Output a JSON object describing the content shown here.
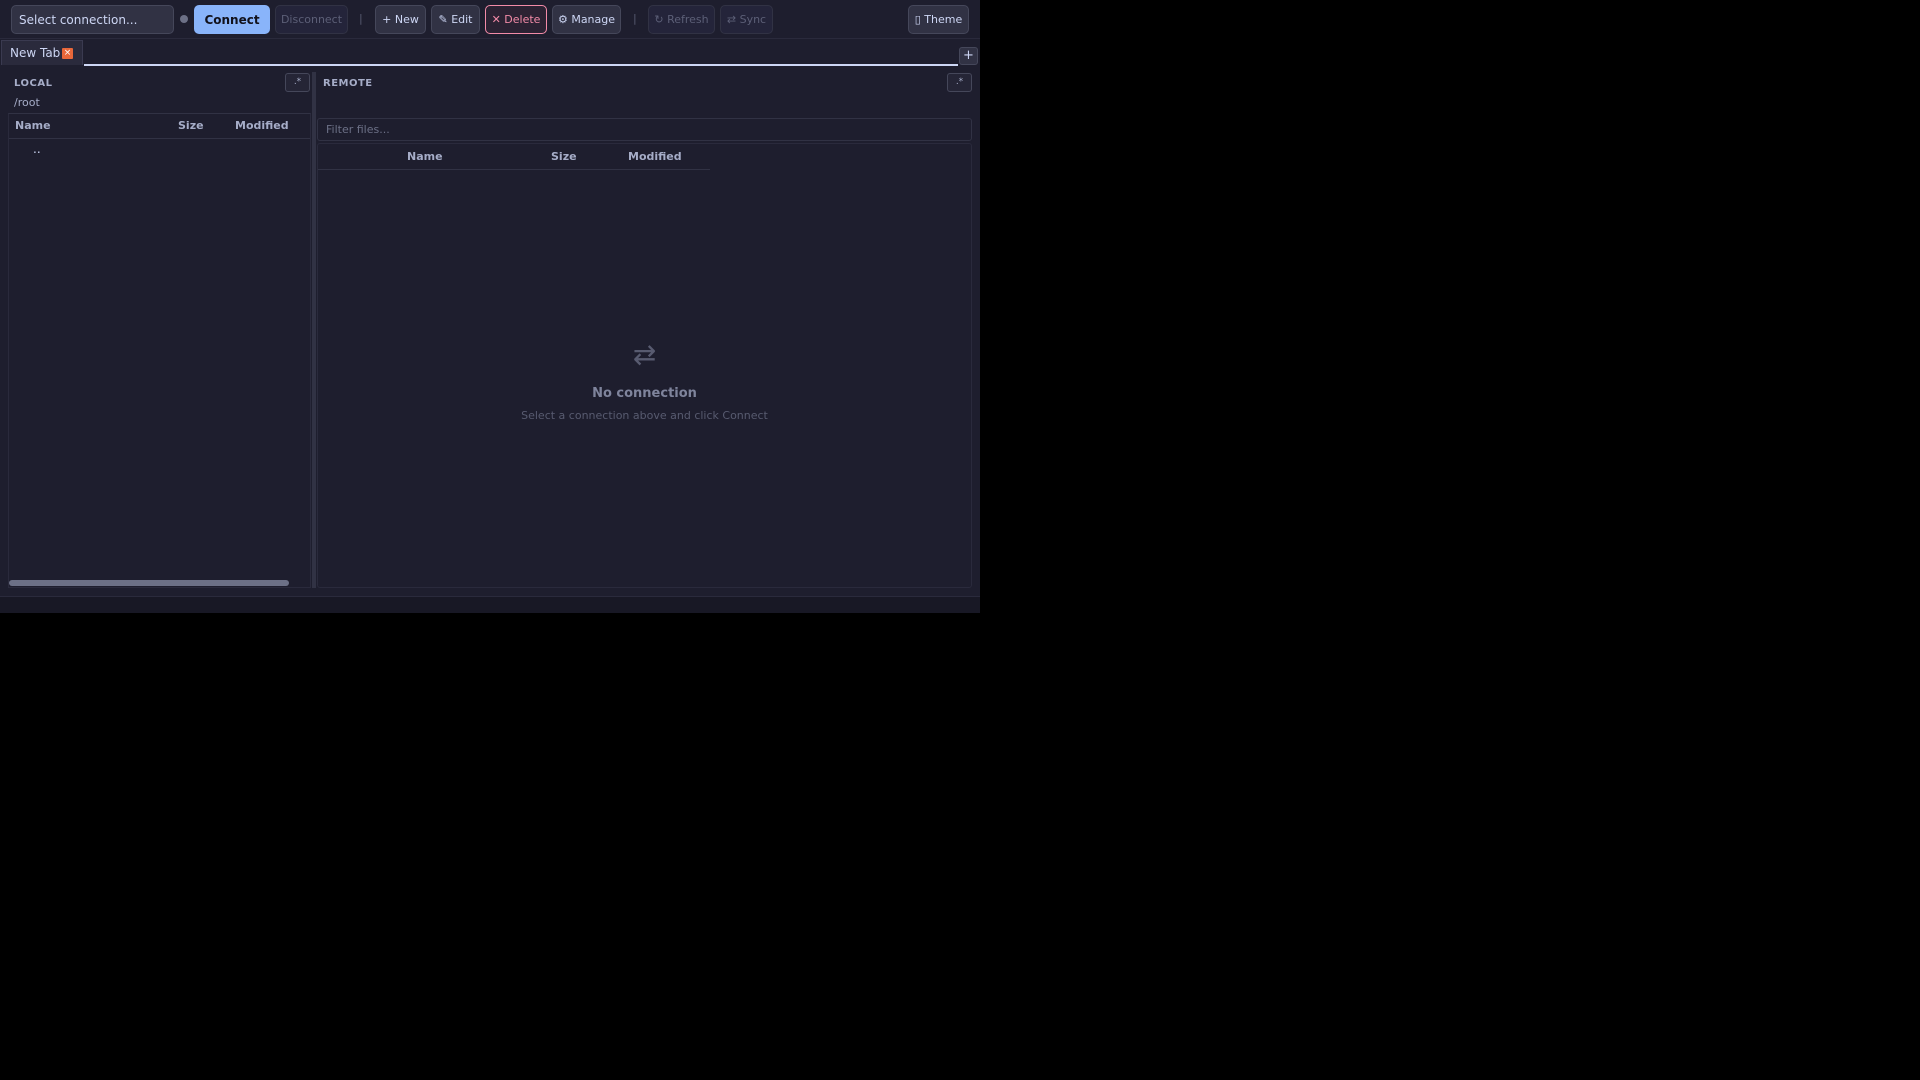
{
  "toolbar": {
    "connection_placeholder": "Select connection...",
    "connect": "Connect",
    "disconnect": "Disconnect",
    "separator": "|",
    "new": "+ New",
    "edit": "✎ Edit",
    "delete": "✕ Delete",
    "manage": "⚙ Manage",
    "refresh": "↻ Refresh",
    "sync": "⇄ Sync",
    "theme": "▯ Theme"
  },
  "tabs": [
    {
      "label": "New Tab",
      "close": "×"
    }
  ],
  "tab_add": "+",
  "local": {
    "title": "LOCAL",
    "regex": ".*",
    "path": "/root",
    "columns": [
      "Name",
      "Size",
      "Modified"
    ],
    "rows": [
      {
        "name": ".."
      }
    ]
  },
  "remote": {
    "title": "REMOTE",
    "regex": ".*",
    "filter_placeholder": "Filter files...",
    "columns": [
      "Name",
      "Size",
      "Modified"
    ],
    "empty_icon": "⇄",
    "empty_title": "No connection",
    "empty_subtitle": "Select a connection above and click Connect"
  },
  "colors": {
    "background": "#1e1e2e",
    "accent": "#89b4fa",
    "danger": "#f38ba8",
    "tab_close": "#e8673a"
  }
}
